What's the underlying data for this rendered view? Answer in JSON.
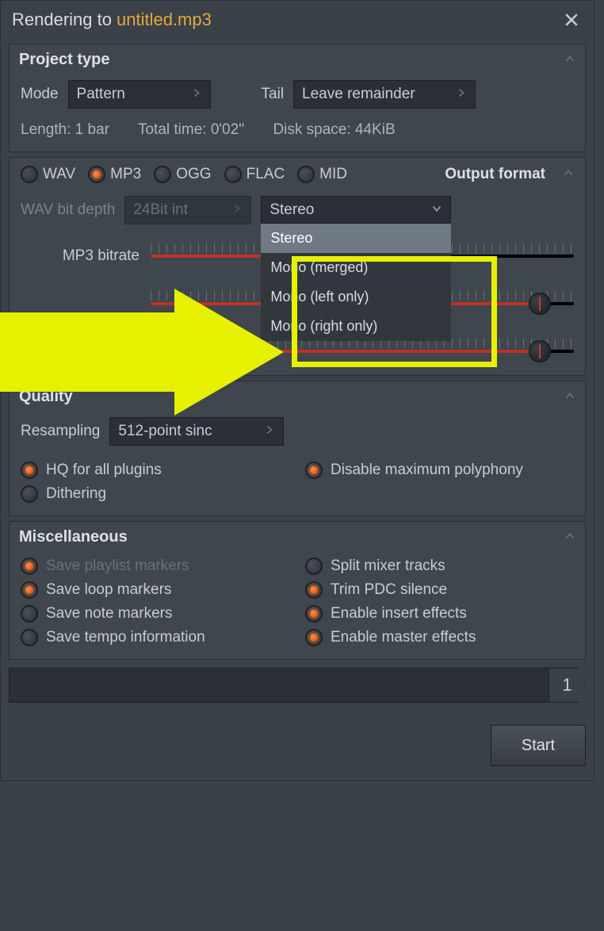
{
  "title": {
    "prefix": "Rendering to",
    "file": "untitled.mp3"
  },
  "project_type": {
    "header": "Project type",
    "mode_label": "Mode",
    "mode_value": "Pattern",
    "tail_label": "Tail",
    "tail_value": "Leave remainder",
    "length": "Length: 1 bar",
    "total_time": "Total time: 0'02''",
    "disk_space": "Disk space: 44KiB"
  },
  "output_format": {
    "header": "Output format",
    "options": [
      {
        "label": "WAV",
        "on": false
      },
      {
        "label": "MP3",
        "on": true
      },
      {
        "label": "OGG",
        "on": false
      },
      {
        "label": "FLAC",
        "on": false
      },
      {
        "label": "MID",
        "on": false
      }
    ],
    "wav_depth_label": "WAV bit depth",
    "wav_depth_value": "24Bit int",
    "stereo_value": "Stereo",
    "stereo_options": [
      "Stereo",
      "Mono (merged)",
      "Mono (left only)",
      "Mono (right only)"
    ],
    "mp3_bitrate_label": "MP3 bitrate"
  },
  "quality": {
    "header": "Quality",
    "resampling_label": "Resampling",
    "resampling_value": "512-point sinc",
    "checks": {
      "hq": {
        "label": "HQ for all plugins",
        "on": true
      },
      "disable_poly": {
        "label": "Disable maximum polyphony",
        "on": true
      },
      "dithering": {
        "label": "Dithering",
        "on": false
      }
    }
  },
  "misc": {
    "header": "Miscellaneous",
    "checks": {
      "save_playlist": {
        "label": "Save playlist markers",
        "on": true,
        "dim": true
      },
      "split_mixer": {
        "label": "Split mixer tracks",
        "on": false
      },
      "save_loop": {
        "label": "Save loop markers",
        "on": true
      },
      "trim_pdc": {
        "label": "Trim PDC silence",
        "on": true
      },
      "save_note": {
        "label": "Save note markers",
        "on": false
      },
      "enable_insert": {
        "label": "Enable insert effects",
        "on": true
      },
      "save_tempo": {
        "label": "Save tempo information",
        "on": false
      },
      "enable_master": {
        "label": "Enable master effects",
        "on": true
      }
    }
  },
  "progress": {
    "count": "1"
  },
  "start_label": "Start"
}
